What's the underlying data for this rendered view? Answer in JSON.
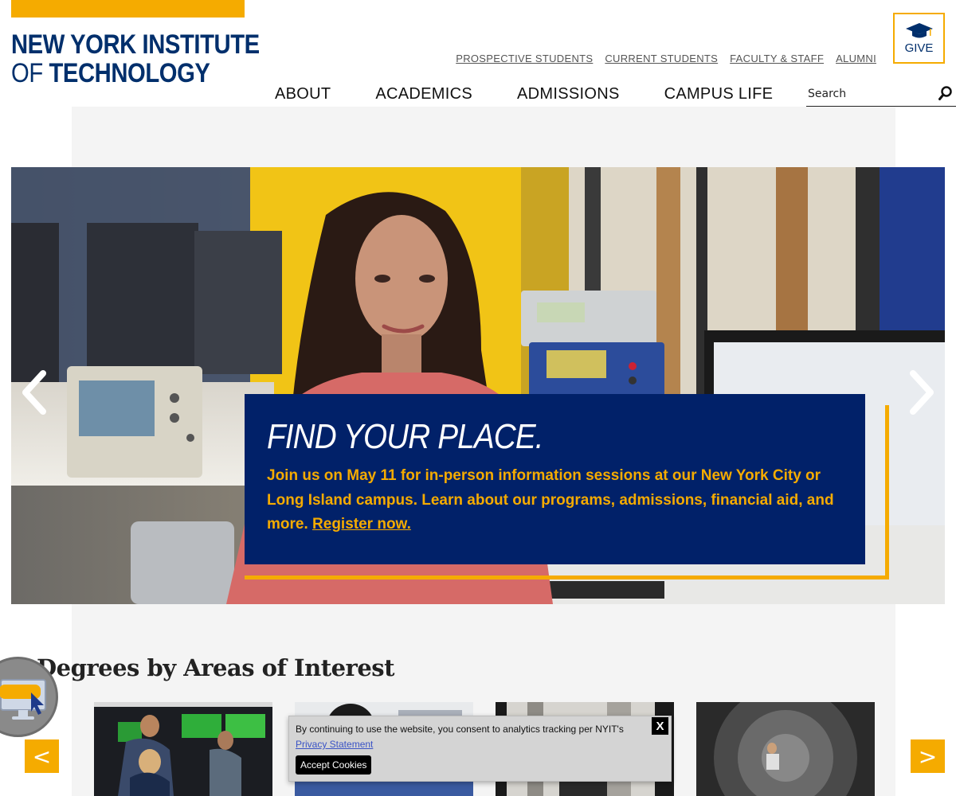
{
  "header": {
    "logo_line1": "NEW YORK INSTITUTE",
    "logo_line2_of": "OF",
    "logo_line2_rest": " TECHNOLOGY",
    "utility_links": [
      "PROSPECTIVE STUDENTS",
      "CURRENT STUDENTS",
      "FACULTY & STAFF",
      "ALUMNI"
    ],
    "give_label": "GIVE",
    "main_nav": [
      "ABOUT",
      "ACADEMICS",
      "ADMISSIONS",
      "CAMPUS LIFE"
    ],
    "search_placeholder": "Search"
  },
  "hero": {
    "title": "FIND YOUR PLACE.",
    "body": "Join us on May 11 for in-person information sessions at our New York City or Long Island campus. Learn about our programs, admissions, financial aid, and more. ",
    "link_label": "Register now."
  },
  "degrees": {
    "title": "Degrees by Areas of Interest",
    "prev_label": "<",
    "next_label": ">"
  },
  "cookie": {
    "message": "By continuing to use the website, you consent to analytics tracking per NYIT's",
    "privacy_label": "Privacy Statement",
    "close_label": "X",
    "accept_label": "Accept Cookies"
  },
  "colors": {
    "brand_blue": "#002f6c",
    "brand_gold": "#f5ab00"
  }
}
